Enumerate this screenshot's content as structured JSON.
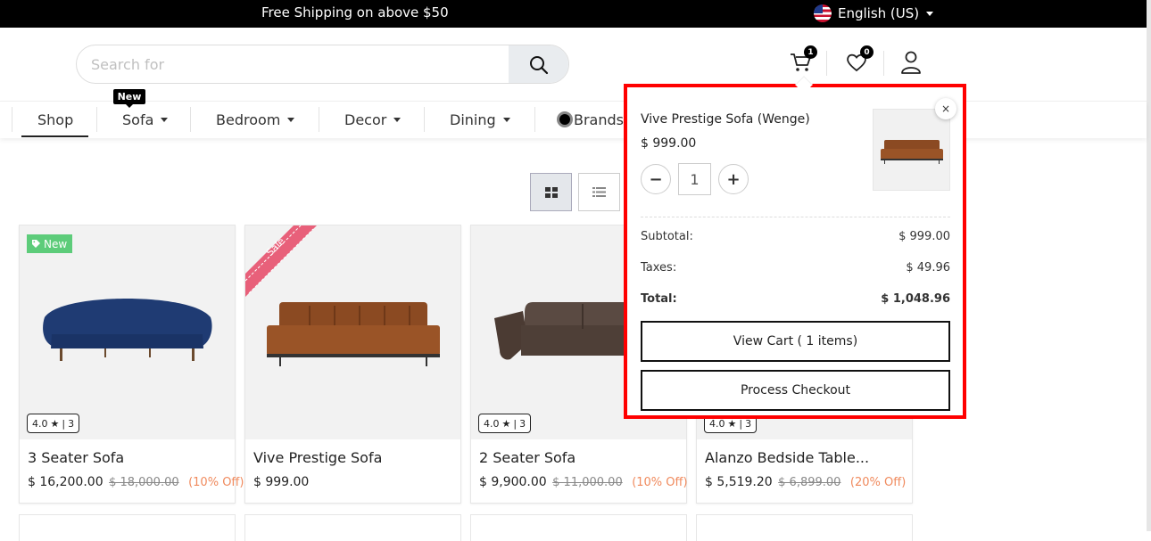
{
  "topbar": {
    "shipping": "Free Shipping on above $50",
    "language": "English (US)"
  },
  "search": {
    "placeholder": "Search for"
  },
  "header": {
    "cart_count": "1",
    "wishlist_count": "0"
  },
  "nav": {
    "new_tag": "New",
    "items": [
      {
        "label": "Shop"
      },
      {
        "label": "Sofa"
      },
      {
        "label": "Bedroom"
      },
      {
        "label": "Decor"
      },
      {
        "label": "Dining"
      },
      {
        "label": "Brands"
      }
    ]
  },
  "products": [
    {
      "badge": "New",
      "rating": "4.0",
      "reviews": "3",
      "title": "3 Seater Sofa",
      "price": "$ 16,200.00",
      "old_price": "$ 18,000.00",
      "discount": "(10% Off)"
    },
    {
      "ribbon": "Sale",
      "title": "Vive Prestige Sofa",
      "price": "$ 999.00"
    },
    {
      "rating": "4.0",
      "reviews": "3",
      "title": "2 Seater Sofa",
      "price": "$ 9,900.00",
      "old_price": "$ 11,000.00",
      "discount": "(10% Off)"
    },
    {
      "rating": "4.0",
      "reviews": "3",
      "title": "Alanzo Bedside Table...",
      "price": "$ 5,519.20",
      "old_price": "$ 6,899.00",
      "discount": "(20% Off)"
    }
  ],
  "cart_popup": {
    "item_name": "Vive Prestige Sofa (Wenge)",
    "item_price": "$ 999.00",
    "quantity": "1",
    "close": "×",
    "subtotal_label": "Subtotal:",
    "subtotal": "$ 999.00",
    "taxes_label": "Taxes:",
    "taxes": "$ 49.96",
    "total_label": "Total:",
    "total": "$ 1,048.96",
    "view_cart": "View Cart ( 1 items)",
    "checkout": "Process Checkout"
  },
  "colors": {
    "highlight_border": "#ff0000",
    "new_badge": "#5dcc7a",
    "sale_ribbon": "#e8607a",
    "discount": "#f08a5d"
  }
}
